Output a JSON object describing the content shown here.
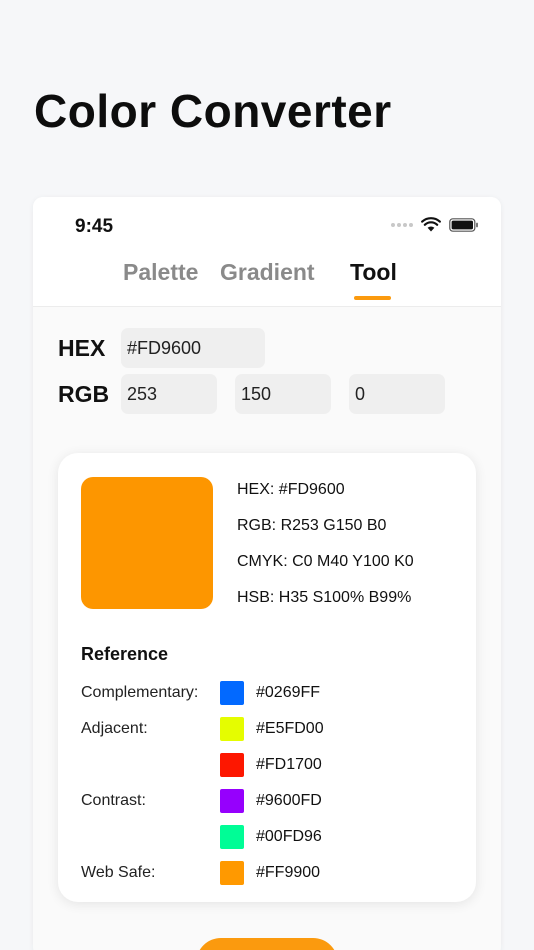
{
  "page": {
    "title": "Color Converter"
  },
  "status_bar": {
    "time": "9:45"
  },
  "tabs": [
    {
      "label": "Palette"
    },
    {
      "label": "Gradient"
    },
    {
      "label": "Tool"
    }
  ],
  "active_tab": "Tool",
  "inputs": {
    "hex_label": "HEX",
    "hex_value": "#FD9600",
    "rgb_label": "RGB",
    "r_value": "253",
    "g_value": "150",
    "b_value": "0"
  },
  "result": {
    "preview_color": "#FD9600",
    "hex_line": "HEX: #FD9600",
    "rgb_line": "RGB: R253 G150 B0",
    "cmyk_line": "CMYK: C0 M40 Y100 K0",
    "hsb_line": "HSB: H35 S100% B99%"
  },
  "reference": {
    "title": "Reference",
    "labels": {
      "complementary": "Complementary:",
      "adjacent": "Adjacent:",
      "contrast": "Contrast:",
      "web_safe": "Web Safe:"
    },
    "colors": [
      {
        "hex": "#0269FF",
        "swatch": "#0269FF"
      },
      {
        "hex": "#E5FD00",
        "swatch": "#E5FD00"
      },
      {
        "hex": "#FD1700",
        "swatch": "#FD1700"
      },
      {
        "hex": "#9600FD",
        "swatch": "#9600FD"
      },
      {
        "hex": "#00FD96",
        "swatch": "#00FD96"
      },
      {
        "hex": "#FF9900",
        "swatch": "#FF9900"
      }
    ]
  },
  "colors": {
    "accent": "#FB9A0E"
  }
}
